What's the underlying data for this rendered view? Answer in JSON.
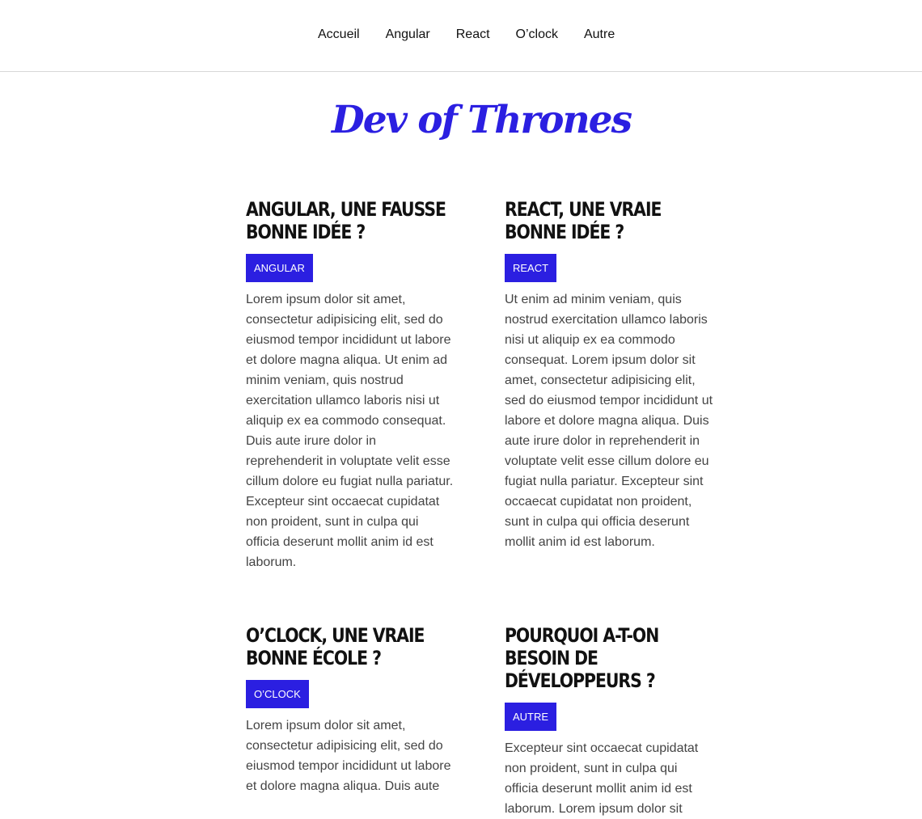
{
  "nav": {
    "items": [
      {
        "label": "Accueil"
      },
      {
        "label": "Angular"
      },
      {
        "label": "React"
      },
      {
        "label": "O’clock"
      },
      {
        "label": "Autre"
      }
    ]
  },
  "site": {
    "title": "Dev of Thrones"
  },
  "posts": [
    {
      "title": "Angular, une fausse bonne idée ?",
      "category": "Angular",
      "text": "Lorem ipsum dolor sit amet, consectetur adipisicing elit, sed do eiusmod tempor incididunt ut labore et dolore magna aliqua. Ut enim ad minim veniam, quis nostrud exercitation ullamco laboris nisi ut aliquip ex ea commodo consequat. Duis aute irure dolor in reprehenderit in voluptate velit esse cillum dolore eu fugiat nulla pariatur. Excepteur sint occaecat cupidatat non proident, sunt in culpa qui officia deserunt mollit anim id est laborum."
    },
    {
      "title": "React, une vraie bonne idée ?",
      "category": "React",
      "text": "Ut enim ad minim veniam, quis nostrud exercitation ullamco laboris nisi ut aliquip ex ea commodo consequat. Lorem ipsum dolor sit amet, consectetur adipisicing elit, sed do eiusmod tempor incididunt ut labore et dolore magna aliqua. Duis aute irure dolor in reprehenderit in voluptate velit esse cillum dolore eu fugiat nulla pariatur. Excepteur sint occaecat cupidatat non proident, sunt in culpa qui officia deserunt mollit anim id est laborum."
    },
    {
      "title": "O’clock, une vraie bonne école ?",
      "category": "O’clock",
      "text": "Lorem ipsum dolor sit amet, consectetur adipisicing elit, sed do eiusmod tempor incididunt ut labore et dolore magna aliqua. Duis aute"
    },
    {
      "title": "Pourquoi a-t-on besoin de développeurs ?",
      "category": "Autre",
      "text": "Excepteur sint occaecat cupidatat non proident, sunt in culpa qui officia deserunt mollit anim id est laborum. Lorem ipsum dolor sit"
    }
  ],
  "colors": {
    "accent": "#2b1fe1",
    "heading": "#111111",
    "body_text": "#444444",
    "divider": "#d8d8d8"
  }
}
